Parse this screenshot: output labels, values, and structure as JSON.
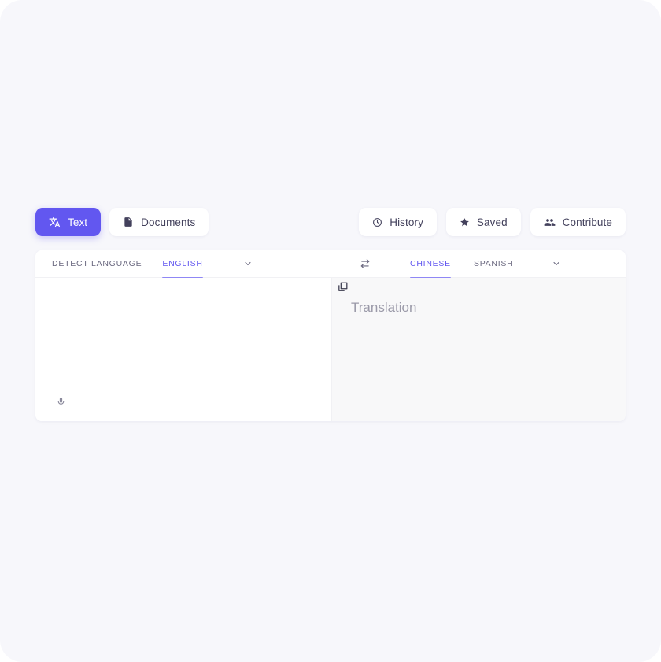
{
  "toolbar": {
    "left": [
      {
        "label": "Text",
        "icon": "translate-icon",
        "active": true
      },
      {
        "label": "Documents",
        "icon": "document-icon",
        "active": false
      }
    ],
    "right": [
      {
        "label": "History",
        "icon": "clock-icon"
      },
      {
        "label": "Saved",
        "icon": "star-icon"
      },
      {
        "label": "Contribute",
        "icon": "people-icon"
      }
    ]
  },
  "translator": {
    "source": {
      "tabs": [
        {
          "label": "DETECT LANGUAGE",
          "selected": false
        },
        {
          "label": "ENGLISH",
          "selected": true
        }
      ],
      "more_icon": "chevron-down-icon",
      "input_value": "",
      "input_placeholder": "",
      "mic_icon": "microphone-icon"
    },
    "swap_icon": "swap-horizontal-icon",
    "target": {
      "tabs": [
        {
          "label": "CHINESE",
          "selected": true
        },
        {
          "label": "SPANISH",
          "selected": false
        }
      ],
      "more_icon": "chevron-down-icon",
      "copy_icon": "copy-icon",
      "placeholder": "Translation"
    }
  },
  "colors": {
    "accent": "#6257f0",
    "accent_underline": "#8f87f5",
    "page_background": "#f7f7fb",
    "card_background": "#ffffff",
    "target_pane_background": "#f8f8f9",
    "text_primary": "#43415c",
    "text_muted": "#6b6980",
    "placeholder": "#9b9aa9"
  }
}
